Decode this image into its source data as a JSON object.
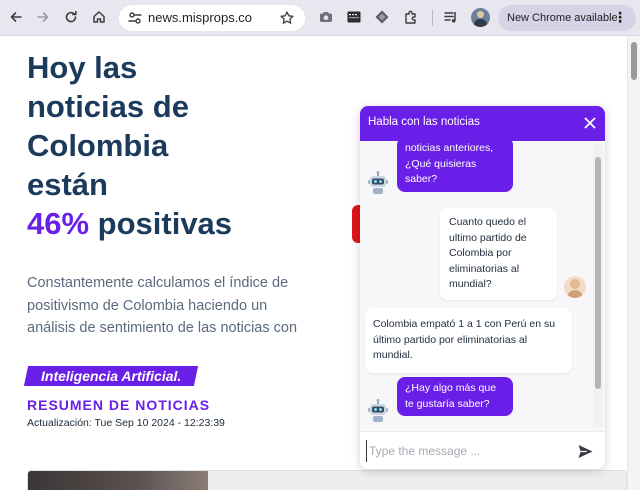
{
  "browser": {
    "url": "news.misprops.co",
    "update_button": "New Chrome available",
    "update_menu": "⋮"
  },
  "hero": {
    "title_lines": [
      "Hoy las",
      "noticias de",
      "Colombia",
      "están"
    ],
    "percent": "46%",
    "title_tail": " positivas",
    "description": "Constantemente calculamos el índice de positivismo de Colombia haciendo un análisis de sentimiento de las noticias con",
    "ai_badge": "Inteligencia Artificial.",
    "news_heading": "RESUMEN DE NOTICIAS",
    "update_label": "Actualización: ",
    "update_time": "Tue Sep 10 2024 - 12:23:39"
  },
  "chat": {
    "title": "Habla con las noticias",
    "messages": [
      {
        "sender": "bot",
        "text": "noticias anteriores, ¿Qué quisieras saber?"
      },
      {
        "sender": "user",
        "text": "Cuanto quedo el ultimo partido de Colombia por eliminatorias al mundial?"
      },
      {
        "sender": "bot",
        "text": "Colombia empató 1 a 1 con Perú en su último partido por eliminatorias al mundial."
      },
      {
        "sender": "bot",
        "text": "¿Hay algo más que te gustaría saber?"
      }
    ],
    "input_placeholder": "Type the message ..."
  },
  "colors": {
    "accent": "#6a1fe8",
    "title": "#1b3a5c",
    "body_text": "#5b6a7e"
  }
}
